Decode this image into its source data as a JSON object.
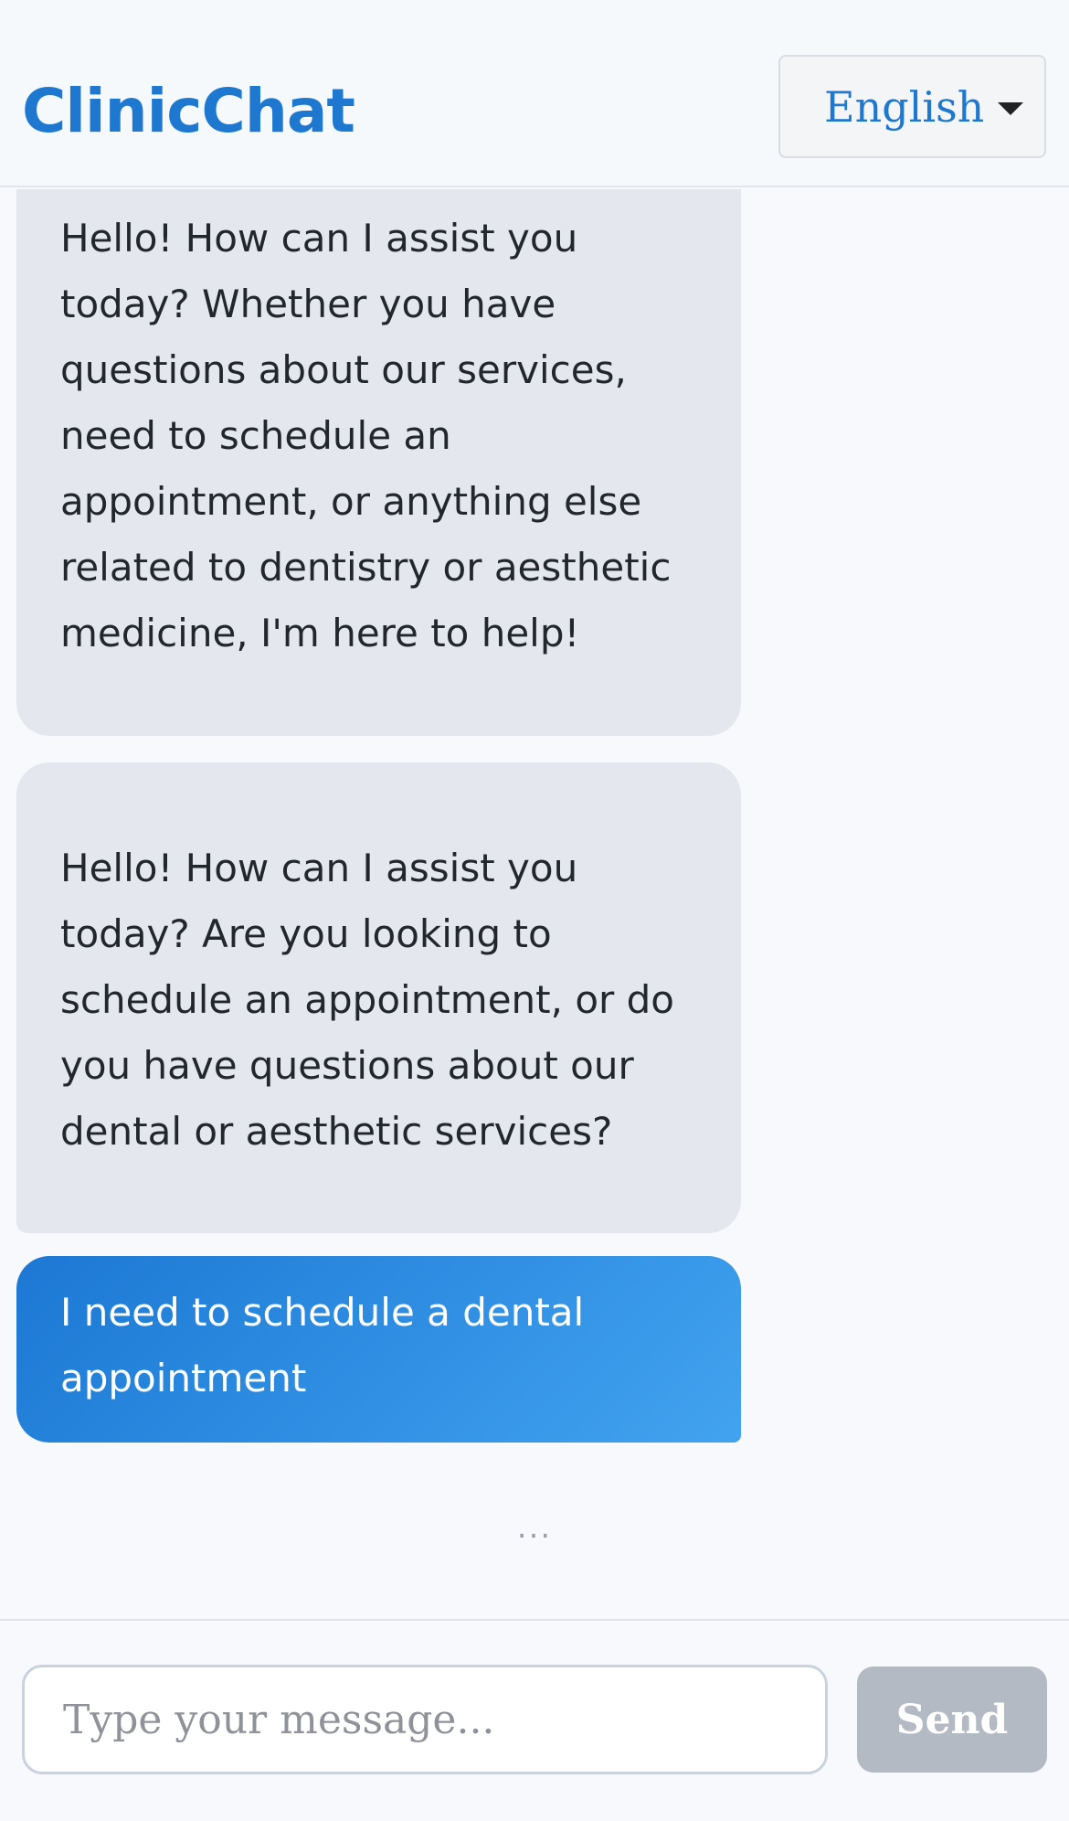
{
  "header": {
    "brand": "ClinicChat",
    "language": {
      "selected": "English"
    }
  },
  "messages": [
    {
      "sender": "bot",
      "text": "Hello! How can I assist you today? Whether you have questions about our services, need to schedule an appointment, or anything else related to dentistry or aesthetic medicine, I'm here to help!"
    },
    {
      "sender": "bot",
      "text": "Hello! How can I assist you today? Are you looking to schedule an appointment, or do you have questions about our dental or aesthetic services?"
    },
    {
      "sender": "user",
      "text": "I need to schedule a dental appointment"
    }
  ],
  "typing_indicator": "...",
  "composer": {
    "placeholder": "Type your message...",
    "value": "",
    "send_label": "Send"
  },
  "colors": {
    "brand": "#1f78cf",
    "bot_bubble": "#e4e8ee",
    "user_bubble_start": "#1c78d4",
    "user_bubble_end": "#42a3f0",
    "send_disabled": "#b3bac4"
  }
}
